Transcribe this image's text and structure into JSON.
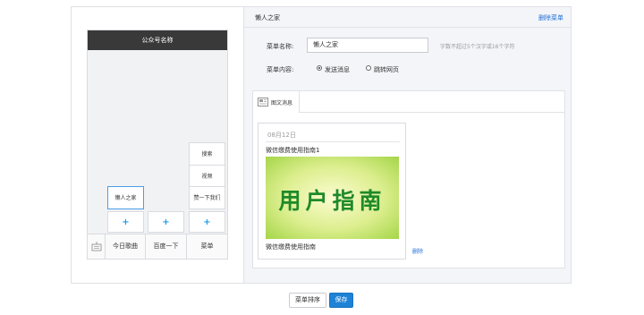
{
  "phone": {
    "header_title": "公众号名称",
    "menu": [
      {
        "label": "今日歌曲"
      },
      {
        "label": "百度一下"
      },
      {
        "label": "菜单"
      }
    ],
    "submenu_col1": [
      "懒人之家"
    ],
    "submenu_col3": [
      "搜索",
      "视频",
      "赞一下我们"
    ],
    "plus": "+"
  },
  "panel": {
    "title": "懒人之家",
    "delete_menu": "删除菜单",
    "name_label": "菜单名称:",
    "name_value": "懒人之家",
    "name_hint": "字数不超过5个汉字或16个字符",
    "content_label": "菜单内容:",
    "radio_send": "发送消息",
    "radio_jump": "跳转网页",
    "tab_label": "图文消息",
    "card": {
      "date": "08月12日",
      "title": "微信缴费使用指南1",
      "cover_text": "用户指南",
      "caption": "微信缴费使用指南"
    },
    "delete_link": "删除"
  },
  "buttons": {
    "sort": "菜单排序",
    "save": "保存"
  },
  "colors": {
    "accent_blue": "#1e82d6",
    "link_blue": "#1e6fd9",
    "phone_header": "#393939",
    "cover_green": "#1f8a2a"
  }
}
